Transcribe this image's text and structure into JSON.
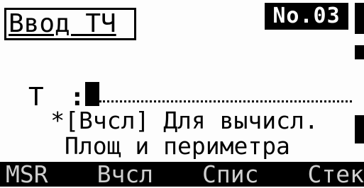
{
  "screen": {
    "title": "Ввод ТЧ",
    "number_badge": "No.03"
  },
  "field": {
    "label": "Т",
    "colon": ":",
    "value": ""
  },
  "hint": {
    "line1": "*[Вчсл] Для вычисл.",
    "line2": "Площ и периметра"
  },
  "softkeys": [
    "MSR",
    "Вчсл",
    "Спис",
    "Стек"
  ]
}
